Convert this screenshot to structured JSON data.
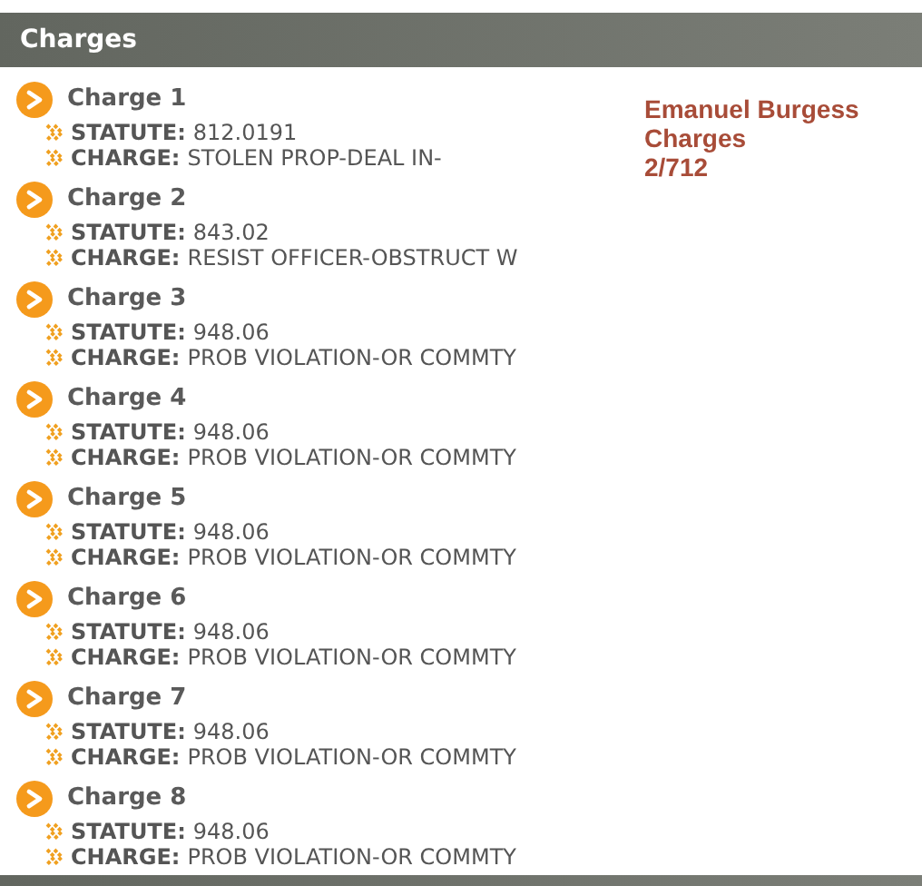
{
  "header": {
    "title": "Charges"
  },
  "charges": [
    {
      "title": "Charge 1",
      "fields": [
        {
          "label": "STATUTE:",
          "value": "812.0191"
        },
        {
          "label": "CHARGE:",
          "value": "STOLEN PROP-DEAL IN-"
        }
      ]
    },
    {
      "title": "Charge 2",
      "fields": [
        {
          "label": "STATUTE:",
          "value": "843.02"
        },
        {
          "label": "CHARGE:",
          "value": "RESIST OFFICER-OBSTRUCT W"
        }
      ]
    },
    {
      "title": "Charge 3",
      "fields": [
        {
          "label": "STATUTE:",
          "value": "948.06"
        },
        {
          "label": "CHARGE:",
          "value": "PROB VIOLATION-OR COMMTY"
        }
      ]
    },
    {
      "title": "Charge 4",
      "fields": [
        {
          "label": "STATUTE:",
          "value": "948.06"
        },
        {
          "label": "CHARGE:",
          "value": "PROB VIOLATION-OR COMMTY"
        }
      ]
    },
    {
      "title": "Charge 5",
      "fields": [
        {
          "label": "STATUTE:",
          "value": "948.06"
        },
        {
          "label": "CHARGE:",
          "value": "PROB VIOLATION-OR COMMTY"
        }
      ]
    },
    {
      "title": "Charge 6",
      "fields": [
        {
          "label": "STATUTE:",
          "value": "948.06"
        },
        {
          "label": "CHARGE:",
          "value": "PROB VIOLATION-OR COMMTY"
        }
      ]
    },
    {
      "title": "Charge 7",
      "fields": [
        {
          "label": "STATUTE:",
          "value": "948.06"
        },
        {
          "label": "CHARGE:",
          "value": "PROB VIOLATION-OR COMMTY"
        }
      ]
    },
    {
      "title": "Charge 8",
      "fields": [
        {
          "label": "STATUTE:",
          "value": "948.06"
        },
        {
          "label": "CHARGE:",
          "value": "PROB VIOLATION-OR COMMTY"
        }
      ]
    }
  ],
  "info": [
    "Emanuel Burgess",
    "Charges",
    "2/712"
  ]
}
